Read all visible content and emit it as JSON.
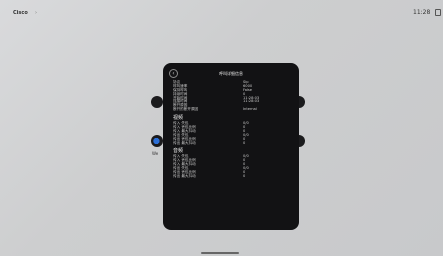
{
  "topbar": {
    "brand": "Cisco",
    "chevron": "›",
    "time": "11:28"
  },
  "panel": {
    "title": "呼叫详细信息",
    "back_icon": "back-arrow-icon",
    "general": [
      {
        "k": "协议",
        "v": "Sip"
      },
      {
        "k": "呼叫速率",
        "v": "6000"
      },
      {
        "k": "保持呼叫",
        "v": "False"
      },
      {
        "k": "持续时间",
        "v": "0"
      },
      {
        "k": "开始时间",
        "v": "11:28:03"
      },
      {
        "k": "连接时间",
        "v": "11:28:03"
      },
      {
        "k": "断开原因",
        "v": ""
      },
      {
        "k": "断开的断开原因",
        "v": "Internal"
      }
    ],
    "video_title": "视频",
    "video": [
      {
        "k": "传入 失包",
        "v": "0/0"
      },
      {
        "k": "传入 丢包比例",
        "v": "0"
      },
      {
        "k": "传入 最大抖动",
        "v": "0"
      },
      {
        "k": "传出 失包",
        "v": "0/0"
      },
      {
        "k": "传出 丢包比例",
        "v": "0"
      },
      {
        "k": "传出 最大抖动",
        "v": "0"
      }
    ],
    "audio_title": "音频",
    "audio": [
      {
        "k": "传入 失包",
        "v": "0/0"
      },
      {
        "k": "传入 丢包比例",
        "v": "0"
      },
      {
        "k": "传入 最大抖动",
        "v": "0"
      },
      {
        "k": "传出 失包",
        "v": "0/0"
      },
      {
        "k": "传出 丢包比例",
        "v": "0"
      },
      {
        "k": "传出 最大抖动",
        "v": "0"
      }
    ]
  },
  "tiles": [
    {
      "name": "tile-top-left",
      "label": "",
      "style": ""
    },
    {
      "name": "tile-top-right",
      "label": "",
      "style": ""
    },
    {
      "name": "tile-webex",
      "label": "We",
      "style": "blue"
    },
    {
      "name": "tile-bottom-right",
      "label": "",
      "style": ""
    }
  ],
  "colors": {
    "panel_bg": "#121214",
    "accent_blue": "#2c6fd6"
  }
}
